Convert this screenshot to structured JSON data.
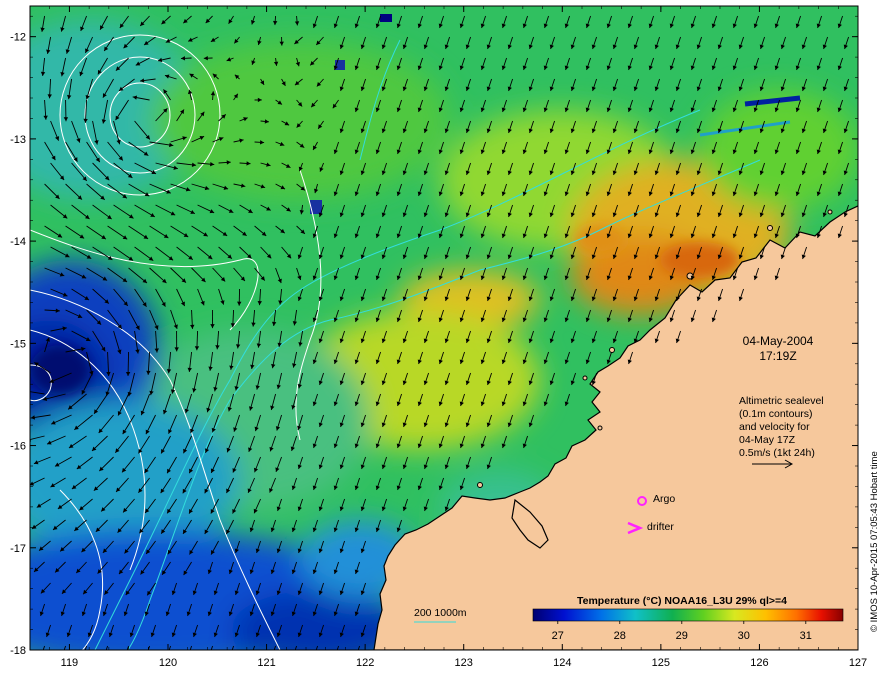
{
  "datetime": {
    "date": "04-May-2004",
    "time": "17:19Z"
  },
  "altimetry_note": [
    "Altimetric sealevel",
    "(0.1m contours)",
    "and velocity for",
    "04-May 17Z",
    "0.5m/s (1kt 24h)"
  ],
  "markers": {
    "argo_label": "Argo",
    "drifter_label": "drifter"
  },
  "bathymetry_legend": {
    "depths": "200  1000m"
  },
  "colorbar": {
    "title": "Temperature (°C) NOAA16_L3U 29% ql>=4",
    "ticks": [
      "27",
      "28",
      "29",
      "30",
      "31"
    ]
  },
  "credit": "© IMOS 10-Apr-2015 07:05:43 Hobart time",
  "chart_data": {
    "type": "heatmap",
    "x_ticks": [
      "119",
      "120",
      "121",
      "122",
      "123",
      "124",
      "125",
      "126",
      "127"
    ],
    "y_ticks": [
      "-12",
      "-13",
      "-14",
      "-15",
      "-16",
      "-17",
      "-18"
    ],
    "xlim": [
      118.6,
      127
    ],
    "ylim": [
      -18,
      -11.7
    ],
    "color_range": [
      26.6,
      31.6
    ],
    "colors": {
      "land": "#f6c89c",
      "coast": "#000000",
      "contour": "#ffffff",
      "bathy": "#33dddd",
      "marker": "#ff22ff"
    }
  }
}
